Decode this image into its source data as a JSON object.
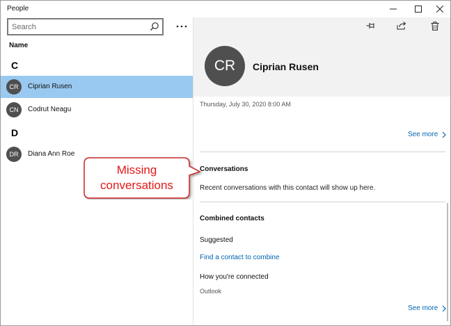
{
  "window": {
    "title": "People"
  },
  "search": {
    "placeholder": "Search"
  },
  "list": {
    "column_header": "Name",
    "groups": [
      {
        "letter": "C",
        "contacts": [
          {
            "initials": "CR",
            "name": "Ciprian Rusen",
            "selected": true
          },
          {
            "initials": "CN",
            "name": "Codrut Neagu",
            "selected": false
          }
        ]
      },
      {
        "letter": "D",
        "contacts": [
          {
            "initials": "DR",
            "name": "Diana Ann Roe",
            "selected": false
          }
        ]
      }
    ]
  },
  "profile": {
    "initials": "CR",
    "name": "Ciprian Rusen",
    "timestamp": "Thursday, July 30, 2020 8:00 AM",
    "see_more_1": "See more",
    "conversations": {
      "title": "Conversations",
      "text": "Recent conversations with this contact will show up here."
    },
    "combined": {
      "title": "Combined contacts",
      "suggested": "Suggested",
      "find_link": "Find a contact to combine",
      "how_connected": "How you're connected",
      "source": "Outlook"
    },
    "see_more_2": "See more"
  },
  "callout": {
    "line1": "Missing",
    "line2": "conversations"
  },
  "icons": {
    "minimize": "minimize-icon",
    "maximize": "maximize-icon",
    "close": "close-icon",
    "search": "search-icon",
    "more": "more-icon",
    "pin": "pin-icon",
    "share": "share-icon",
    "delete": "trash-icon",
    "chevron": "chevron-right-icon"
  },
  "colors": {
    "selection": "#99c9f0",
    "link": "#0063b1",
    "avatar": "#4f4f4f",
    "callout_text": "#e21818",
    "callout_border": "#c62828"
  }
}
